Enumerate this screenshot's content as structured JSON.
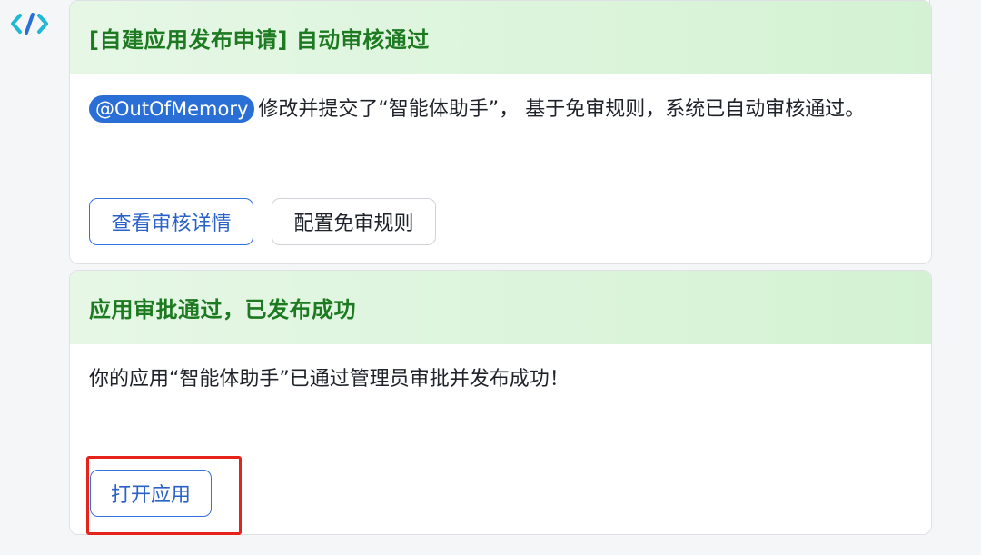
{
  "app": {
    "logo_icon": "code-brackets-icon",
    "logo_colors": [
      "#1fb8d6",
      "#2a6fd6"
    ]
  },
  "toolbar": {
    "icons": [
      "clipboard-icon",
      "swap-icon",
      "code-icon",
      "copy-icon",
      "more-icon"
    ]
  },
  "card_auto_review": {
    "title": "[自建应用发布申请] 自动审核通过",
    "mention": "@OutOfMemory",
    "message": "修改并提交了“智能体助手”， 基于免审规则，系统已自动审核通过。",
    "buttons": {
      "view_details": "查看审核详情",
      "config_rules": "配置免审规则"
    }
  },
  "card_published": {
    "title": "应用审批通过，已发布成功",
    "message": "你的应用“智能体助手”已通过管理员审批并发布成功！",
    "buttons": {
      "open_app": "打开应用"
    }
  },
  "colors": {
    "header_green": "#d4f2d3",
    "title_green": "#1d7a21",
    "primary_blue": "#3370e0",
    "highlight_red": "#e5231b"
  }
}
